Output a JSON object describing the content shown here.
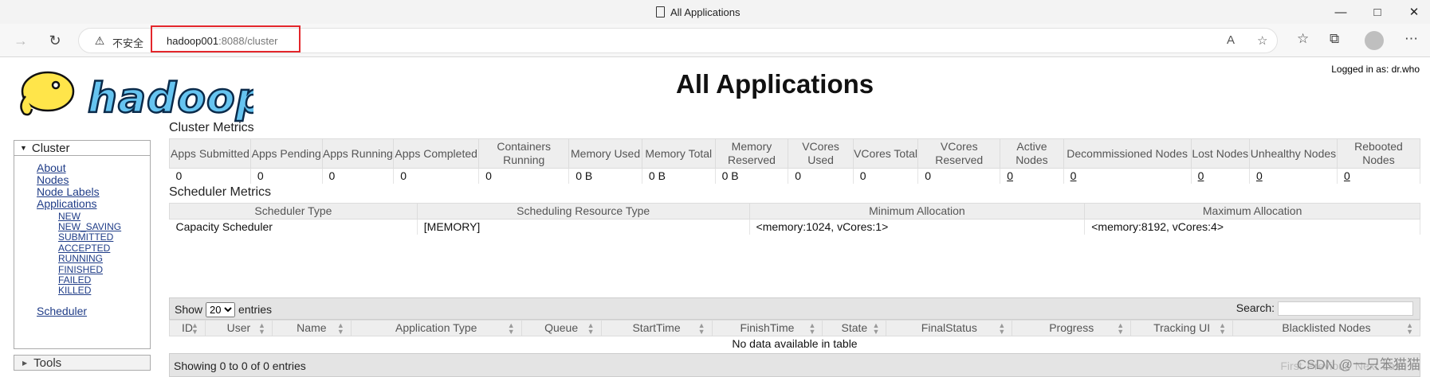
{
  "window": {
    "title": "All Applications",
    "min": "—",
    "max": "□",
    "close": "✕"
  },
  "nav": {
    "insecure_label": "不安全",
    "url_host": "hadoop001",
    "url_rest": ":8088/cluster"
  },
  "header": {
    "logged_in": "Logged in as: dr.who",
    "title": "All Applications"
  },
  "sidebar": {
    "cluster": "Cluster",
    "links": [
      "About",
      "Nodes",
      "Node Labels",
      "Applications"
    ],
    "states": [
      "NEW",
      "NEW_SAVING",
      "SUBMITTED",
      "ACCEPTED",
      "RUNNING",
      "FINISHED",
      "FAILED",
      "KILLED"
    ],
    "scheduler": "Scheduler",
    "tools": "Tools"
  },
  "cluster_metrics": {
    "title": "Cluster Metrics",
    "headers": [
      "Apps Submitted",
      "Apps Pending",
      "Apps Running",
      "Apps Completed",
      "Containers Running",
      "Memory Used",
      "Memory Total",
      "Memory Reserved",
      "VCores Used",
      "VCores Total",
      "VCores Reserved",
      "Active Nodes",
      "Decommissioned Nodes",
      "Lost Nodes",
      "Unhealthy Nodes",
      "Rebooted Nodes"
    ],
    "values": [
      "0",
      "0",
      "0",
      "0",
      "0",
      "0 B",
      "0 B",
      "0 B",
      "0",
      "0",
      "0",
      "0",
      "0",
      "0",
      "0",
      "0"
    ]
  },
  "scheduler_metrics": {
    "title": "Scheduler Metrics",
    "headers": [
      "Scheduler Type",
      "Scheduling Resource Type",
      "Minimum Allocation",
      "Maximum Allocation"
    ],
    "values": [
      "Capacity Scheduler",
      "[MEMORY]",
      "<memory:1024, vCores:1>",
      "<memory:8192, vCores:4>"
    ]
  },
  "apps_table": {
    "show_label": "Show",
    "entries_label": "entries",
    "page_size": "20",
    "search_label": "Search:",
    "headers": [
      "ID",
      "User",
      "Name",
      "Application Type",
      "Queue",
      "StartTime",
      "FinishTime",
      "State",
      "FinalStatus",
      "Progress",
      "Tracking UI",
      "Blacklisted Nodes"
    ],
    "empty": "No data available in table",
    "info": "Showing 0 to 0 of 0 entries",
    "pager": [
      "First",
      "Previous",
      "Next",
      "Last"
    ]
  },
  "watermark": "CSDN @一只笨猫猫"
}
